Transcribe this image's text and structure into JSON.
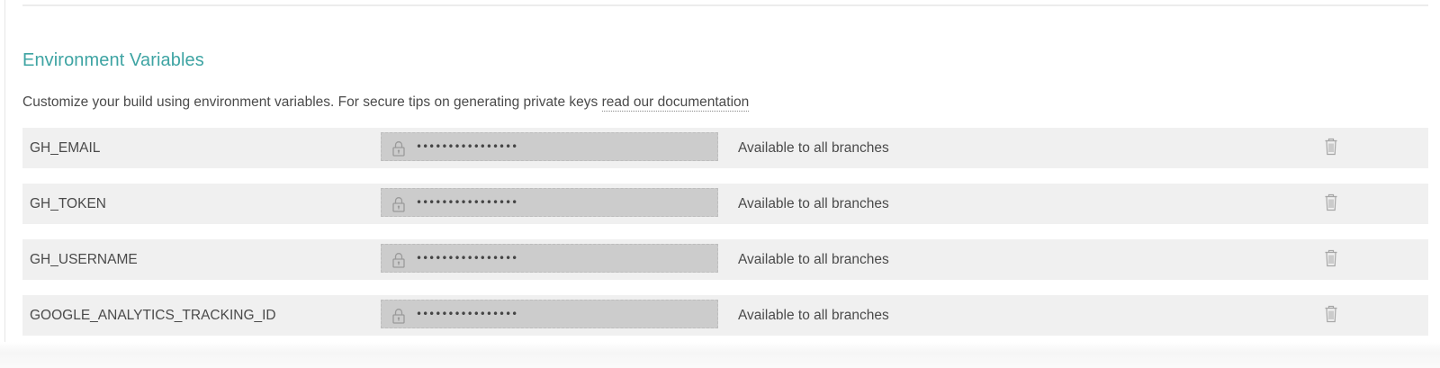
{
  "section": {
    "title": "Environment Variables",
    "description_text": "Customize your build using environment variables. For secure tips on generating private keys ",
    "doc_link_label": "read our documentation"
  },
  "variables": [
    {
      "name": "GH_EMAIL",
      "masked_value": "••••••••••••••••",
      "availability": "Available to all branches"
    },
    {
      "name": "GH_TOKEN",
      "masked_value": "••••••••••••••••",
      "availability": "Available to all branches"
    },
    {
      "name": "GH_USERNAME",
      "masked_value": "••••••••••••••••",
      "availability": "Available to all branches"
    },
    {
      "name": "GOOGLE_ANALYTICS_TRACKING_ID",
      "masked_value": "••••••••••••••••",
      "availability": "Available to all branches"
    }
  ],
  "icons": {
    "lock": "lock-icon",
    "delete": "trash-icon"
  },
  "colors": {
    "title": "#3ea4a3",
    "row_background": "#f0f0f0",
    "field_background": "#cccccc",
    "text": "#4a4a4a"
  }
}
